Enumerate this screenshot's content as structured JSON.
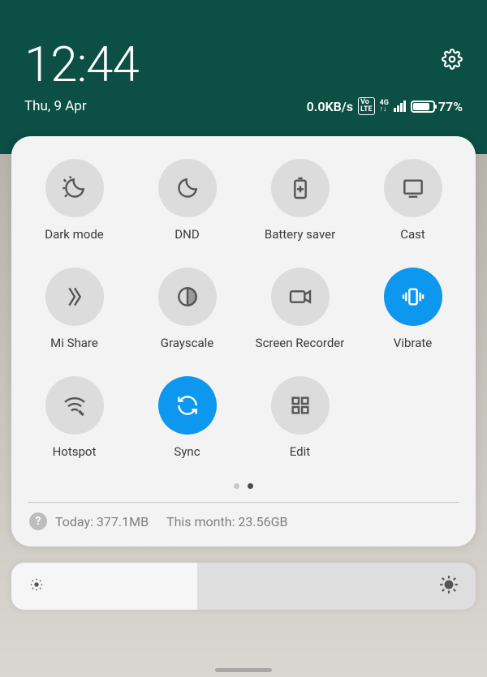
{
  "header": {
    "time": "12:44",
    "date": "Thu, 9 Apr"
  },
  "status": {
    "network_speed": "0.0KB/s",
    "volte": "Vo\nLTE",
    "net_gen": "4G",
    "battery_percent": "77%",
    "battery_fill_pct": 77
  },
  "tiles": [
    {
      "key": "dark-mode",
      "label": "Dark mode",
      "active": false
    },
    {
      "key": "dnd",
      "label": "DND",
      "active": false
    },
    {
      "key": "battery-saver",
      "label": "Battery saver",
      "active": false
    },
    {
      "key": "cast",
      "label": "Cast",
      "active": false
    },
    {
      "key": "mi-share",
      "label": "Mi Share",
      "active": false
    },
    {
      "key": "grayscale",
      "label": "Grayscale",
      "active": false
    },
    {
      "key": "screen-recorder",
      "label": "Screen Recorder",
      "active": false
    },
    {
      "key": "vibrate",
      "label": "Vibrate",
      "active": true
    },
    {
      "key": "hotspot",
      "label": "Hotspot",
      "active": false
    },
    {
      "key": "sync",
      "label": "Sync",
      "active": true
    },
    {
      "key": "edit",
      "label": "Edit",
      "active": false
    }
  ],
  "pager": {
    "count": 2,
    "active": 1
  },
  "data_usage": {
    "today_label": "Today: 377.1MB",
    "month_label": "This month: 23.56GB"
  },
  "brightness": {
    "level_pct": 40
  },
  "colors": {
    "accent": "#0d97ef"
  }
}
